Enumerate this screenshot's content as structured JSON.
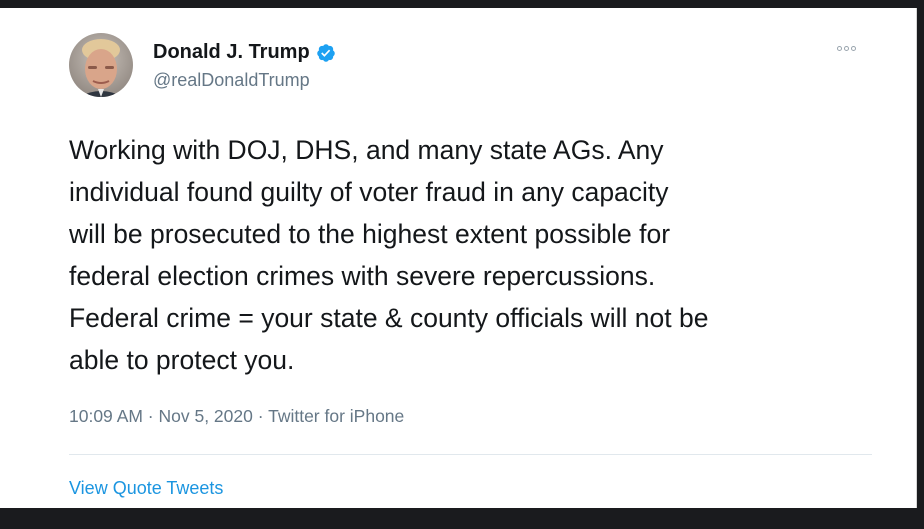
{
  "tweet": {
    "author": {
      "display_name": "Donald J. Trump",
      "handle": "@realDonaldTrump",
      "verified": true,
      "avatar_icon": "profile-photo"
    },
    "text_lines": [
      "Working with DOJ, DHS, and many state AGs. Any",
      "individual found guilty of voter fraud in any capacity",
      "will be prosecuted to the highest extent possible for",
      "federal election crimes with severe repercussions.",
      "Federal crime = your state & county officials will not be",
      "able to protect you."
    ],
    "meta": "10:09 AM · Nov 5, 2020 · Twitter for iPhone",
    "quote_link": "View Quote Tweets",
    "more_icon": "more-options-icon"
  },
  "colors": {
    "text_primary": "#14171a",
    "text_secondary": "#657786",
    "link": "#1b95e0",
    "verified": "#1da1f2",
    "background": "#ffffff",
    "frame": "#1a1b1e"
  }
}
